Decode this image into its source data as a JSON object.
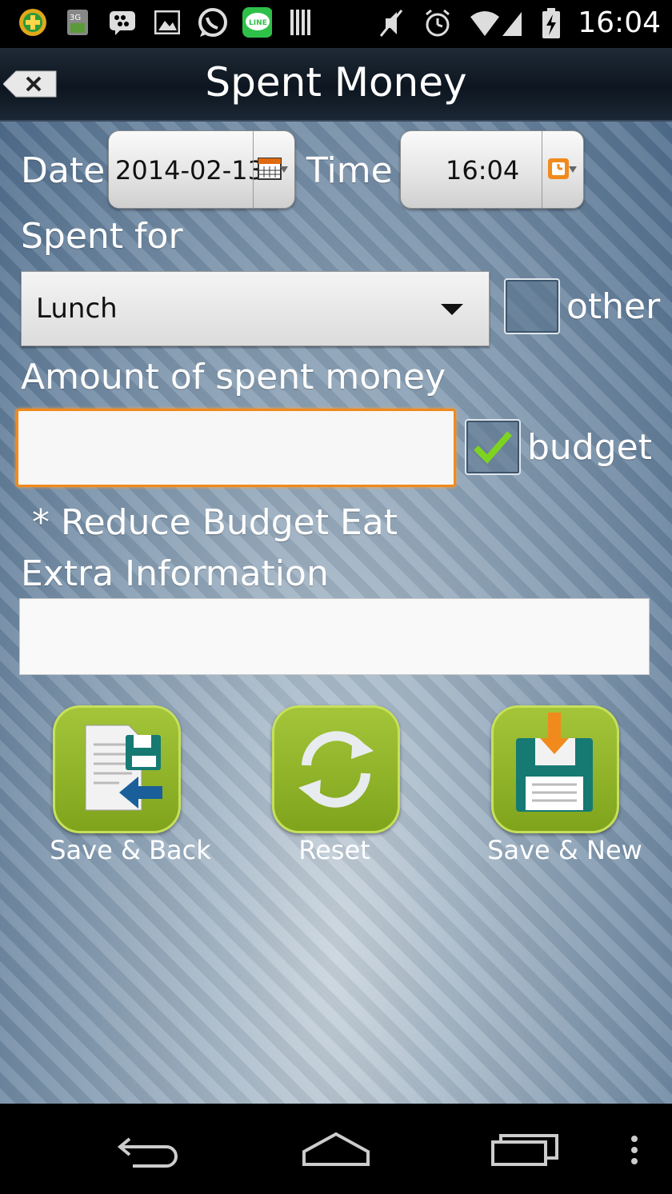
{
  "status_bar": {
    "time": "16:04",
    "left_icons": [
      "plus-app-icon",
      "3g-sim-icon",
      "bbm-icon",
      "gallery-icon",
      "whatsapp-icon",
      "line-icon",
      "barcode-icon"
    ],
    "right_icons": [
      "mute-icon",
      "alarm-icon",
      "wifi-icon",
      "signal-icon",
      "battery-charging-icon"
    ]
  },
  "header": {
    "title": "Spent Money"
  },
  "form": {
    "date_label": "Date",
    "date_value": "2014-02-13",
    "time_label": "Time",
    "time_value": "16:04",
    "spent_for_label": "Spent for",
    "spent_for_value": "Lunch",
    "other_label": "other",
    "other_checked": false,
    "amount_label": "Amount of spent money",
    "amount_value": "",
    "budget_label": "budget",
    "budget_checked": true,
    "budget_note": " * Reduce Budget Eat",
    "extra_label": "Extra Information",
    "extra_value": ""
  },
  "actions": {
    "save_back": "Save & Back",
    "reset": "Reset",
    "save_new": "Save & New"
  },
  "colors": {
    "accent_orange": "#f08a1c",
    "button_green": "#8fb32a",
    "titlebar_dark": "#0d1620"
  }
}
